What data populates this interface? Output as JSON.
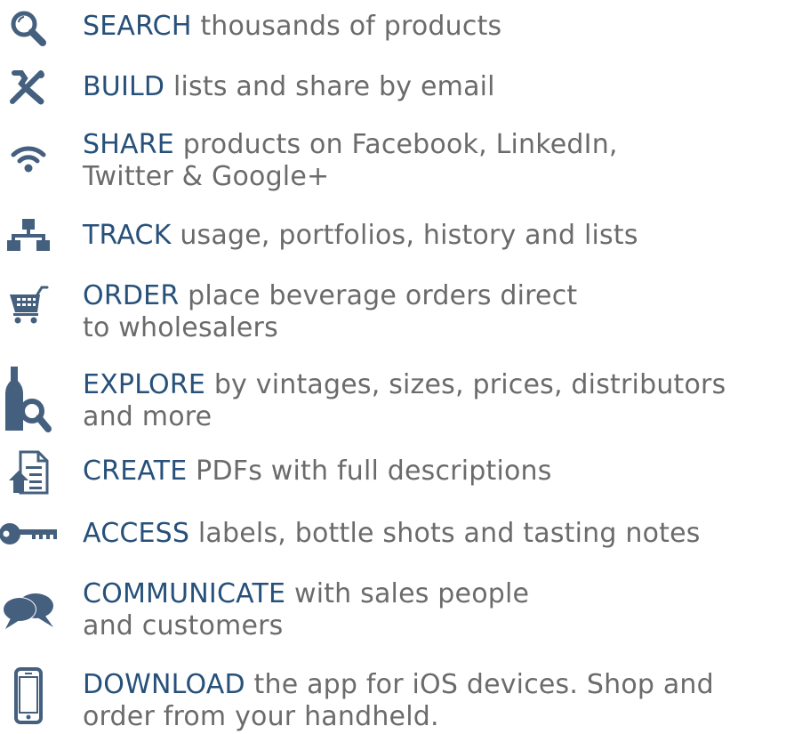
{
  "colors": {
    "icon": "#44607e",
    "keyword": "#27517a",
    "text": "#6b6b6b"
  },
  "features": [
    {
      "icon": "search-icon",
      "keyword": "SEARCH",
      "line1": "thousands of products",
      "line2": ""
    },
    {
      "icon": "tools-icon",
      "keyword": "BUILD",
      "line1": "lists and share by email",
      "line2": ""
    },
    {
      "icon": "wifi-icon",
      "keyword": "SHARE",
      "line1": "products on Facebook, LinkedIn,",
      "line2": "Twitter & Google+"
    },
    {
      "icon": "sitemap-icon",
      "keyword": "TRACK",
      "line1": "usage, portfolios, history and lists",
      "line2": ""
    },
    {
      "icon": "cart-icon",
      "keyword": "ORDER",
      "line1": "place beverage orders direct",
      "line2": "to wholesalers"
    },
    {
      "icon": "bottle-search-icon",
      "keyword": "EXPLORE",
      "line1": "by vintages, sizes, prices, distributors",
      "line2": "and more"
    },
    {
      "icon": "document-upload-icon",
      "keyword": "CREATE",
      "line1": "PDFs with full descriptions",
      "line2": ""
    },
    {
      "icon": "key-icon",
      "keyword": "ACCESS",
      "line1": "labels, bottle shots and tasting notes",
      "line2": ""
    },
    {
      "icon": "chat-bubbles-icon",
      "keyword": "COMMUNICATE",
      "line1": "with sales people",
      "line2": "and customers"
    },
    {
      "icon": "phone-icon",
      "keyword": "DOWNLOAD",
      "line1": "the app for iOS devices. Shop and",
      "line2": "order from your handheld."
    }
  ]
}
